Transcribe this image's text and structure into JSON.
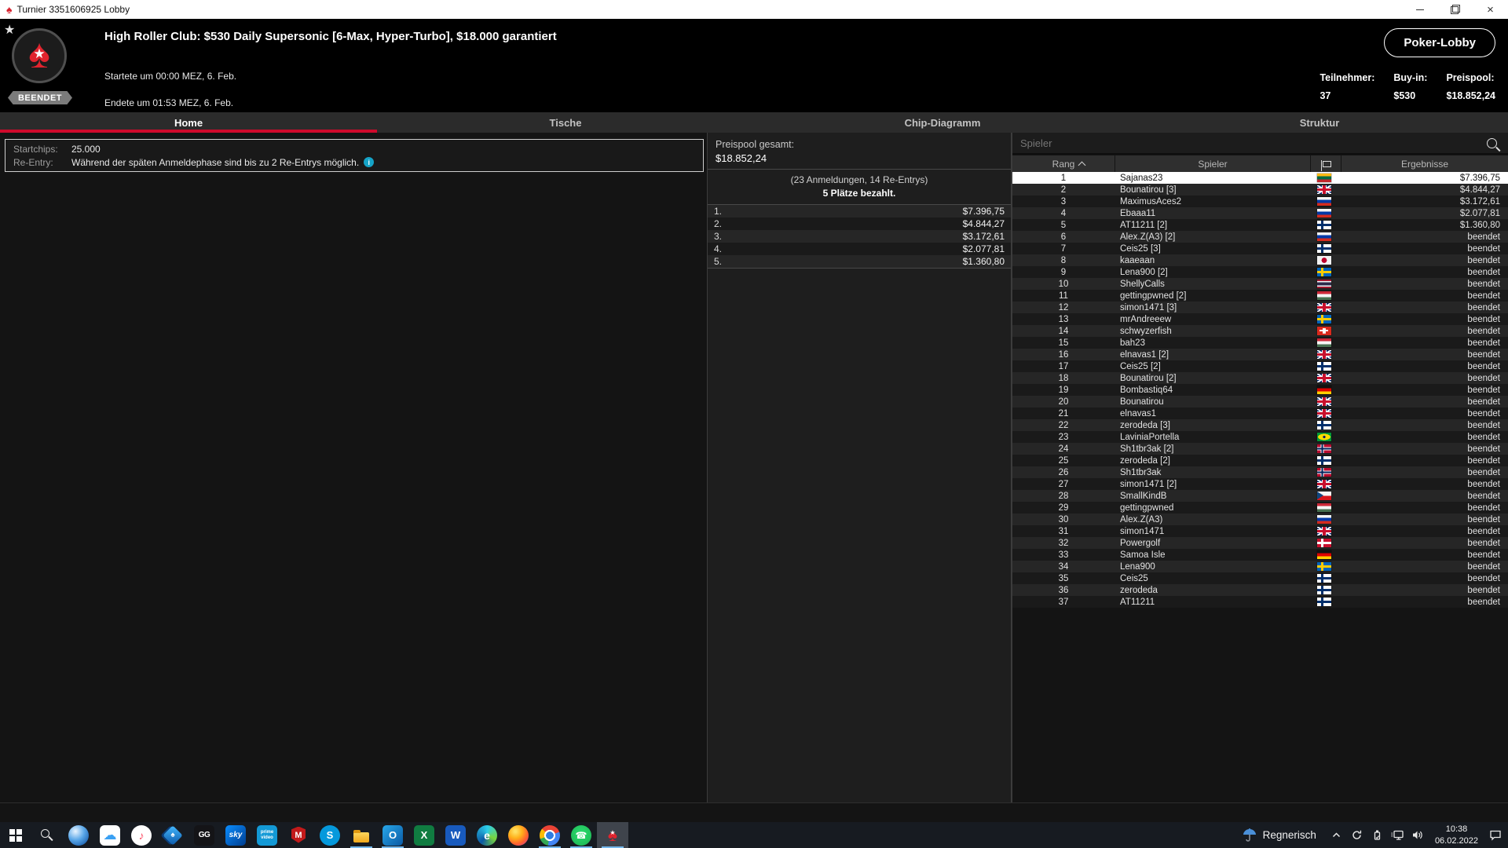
{
  "window": {
    "title": "Turnier 3351606925 Lobby"
  },
  "header": {
    "status_badge": "BEENDET",
    "title": "High Roller Club: $530 Daily Supersonic [6-Max, Hyper-Turbo], $18.000 garantiert",
    "started": "Startete um 00:00 MEZ, 6. Feb.",
    "ended": "Endete um 01:53 MEZ, 6. Feb.",
    "lobby_button": "Poker-Lobby",
    "stats": [
      {
        "label": "Teilnehmer:",
        "value": "37"
      },
      {
        "label": "Buy-in:",
        "value": "$530"
      },
      {
        "label": "Preispool:",
        "value": "$18.852,24"
      }
    ]
  },
  "tabs": [
    {
      "label": "Home",
      "active": true
    },
    {
      "label": "Tische",
      "active": false
    },
    {
      "label": "Chip-Diagramm",
      "active": false
    },
    {
      "label": "Struktur",
      "active": false
    }
  ],
  "info_panel": {
    "startchips_label": "Startchips:",
    "startchips_value": "25.000",
    "reentry_label": "Re-Entry:",
    "reentry_value": "Während der späten Anmeldephase sind bis zu 2 Re-Entrys möglich."
  },
  "prize_panel": {
    "total_label": "Preispool gesamt:",
    "total_value": "$18.852,24",
    "entries_note": "(23 Anmeldungen, 14 Re-Entrys)",
    "paid_note": "5 Plätze bezahlt.",
    "prizes": [
      {
        "place": "1.",
        "amount": "$7.396,75"
      },
      {
        "place": "2.",
        "amount": "$4.844,27"
      },
      {
        "place": "3.",
        "amount": "$3.172,61"
      },
      {
        "place": "4.",
        "amount": "$2.077,81"
      },
      {
        "place": "5.",
        "amount": "$1.360,80"
      }
    ]
  },
  "players_panel": {
    "search_placeholder": "Spieler",
    "columns": {
      "rank": "Rang",
      "player": "Spieler",
      "results": "Ergebnisse"
    },
    "rows": [
      {
        "rank": "1",
        "name": "Sajanas23",
        "country": "lt",
        "result": "$7.396,75",
        "selected": true
      },
      {
        "rank": "2",
        "name": "Bounatirou [3]",
        "country": "gb",
        "result": "$4.844,27"
      },
      {
        "rank": "3",
        "name": "MaximusAces2",
        "country": "ru",
        "result": "$3.172,61"
      },
      {
        "rank": "4",
        "name": "Ebaaa11",
        "country": "ru",
        "result": "$2.077,81"
      },
      {
        "rank": "5",
        "name": "AT11211 [2]",
        "country": "fi",
        "result": "$1.360,80"
      },
      {
        "rank": "6",
        "name": "Alex.Z(A3) [2]",
        "country": "ru",
        "result": "beendet"
      },
      {
        "rank": "7",
        "name": "Ceis25 [3]",
        "country": "fi",
        "result": "beendet"
      },
      {
        "rank": "8",
        "name": "kaaeaan",
        "country": "jp",
        "result": "beendet"
      },
      {
        "rank": "9",
        "name": "Lena900 [2]",
        "country": "se",
        "result": "beendet"
      },
      {
        "rank": "10",
        "name": "ShellyCalls",
        "country": "th",
        "result": "beendet"
      },
      {
        "rank": "11",
        "name": "gettingpwned [2]",
        "country": "hu",
        "result": "beendet"
      },
      {
        "rank": "12",
        "name": "simon1471 [3]",
        "country": "gb",
        "result": "beendet"
      },
      {
        "rank": "13",
        "name": "mrAndreeew",
        "country": "se",
        "result": "beendet"
      },
      {
        "rank": "14",
        "name": "schwyzerfish",
        "country": "ch",
        "result": "beendet"
      },
      {
        "rank": "15",
        "name": "bah23",
        "country": "hu",
        "result": "beendet"
      },
      {
        "rank": "16",
        "name": "elnavas1 [2]",
        "country": "gb",
        "result": "beendet"
      },
      {
        "rank": "17",
        "name": "Ceis25 [2]",
        "country": "fi",
        "result": "beendet"
      },
      {
        "rank": "18",
        "name": "Bounatirou [2]",
        "country": "gb",
        "result": "beendet"
      },
      {
        "rank": "19",
        "name": "Bombastiq64",
        "country": "de",
        "result": "beendet"
      },
      {
        "rank": "20",
        "name": "Bounatirou",
        "country": "gb",
        "result": "beendet"
      },
      {
        "rank": "21",
        "name": "elnavas1",
        "country": "gb",
        "result": "beendet"
      },
      {
        "rank": "22",
        "name": "zerodeda [3]",
        "country": "fi",
        "result": "beendet"
      },
      {
        "rank": "23",
        "name": "LaviniaPortella",
        "country": "br",
        "result": "beendet"
      },
      {
        "rank": "24",
        "name": "Sh1tbr3ak [2]",
        "country": "no",
        "result": "beendet"
      },
      {
        "rank": "25",
        "name": "zerodeda [2]",
        "country": "fi",
        "result": "beendet"
      },
      {
        "rank": "26",
        "name": "Sh1tbr3ak",
        "country": "no",
        "result": "beendet"
      },
      {
        "rank": "27",
        "name": "simon1471 [2]",
        "country": "gb",
        "result": "beendet"
      },
      {
        "rank": "28",
        "name": "SmallKindB",
        "country": "cz",
        "result": "beendet"
      },
      {
        "rank": "29",
        "name": "gettingpwned",
        "country": "hu",
        "result": "beendet"
      },
      {
        "rank": "30",
        "name": "Alex.Z(A3)",
        "country": "ru",
        "result": "beendet"
      },
      {
        "rank": "31",
        "name": "simon1471",
        "country": "gb",
        "result": "beendet"
      },
      {
        "rank": "32",
        "name": "Powergolf",
        "country": "dk",
        "result": "beendet"
      },
      {
        "rank": "33",
        "name": "Samoa Isle",
        "country": "de",
        "result": "beendet"
      },
      {
        "rank": "34",
        "name": "Lena900",
        "country": "se",
        "result": "beendet"
      },
      {
        "rank": "35",
        "name": "Ceis25",
        "country": "fi",
        "result": "beendet"
      },
      {
        "rank": "36",
        "name": "zerodeda",
        "country": "fi",
        "result": "beendet"
      },
      {
        "rank": "37",
        "name": "AT11211",
        "country": "fi",
        "result": "beendet"
      }
    ]
  },
  "taskbar": {
    "apps": [
      {
        "name": "start"
      },
      {
        "name": "search"
      },
      {
        "name": "chat-app"
      },
      {
        "name": "icloud"
      },
      {
        "name": "apple-music"
      },
      {
        "name": "poker-cards"
      },
      {
        "name": "ggpoker",
        "glyph": "GG"
      },
      {
        "name": "sky",
        "glyph": "sky"
      },
      {
        "name": "prime-video",
        "glyph": "prime video"
      },
      {
        "name": "mcafee",
        "glyph": "M"
      },
      {
        "name": "skype",
        "glyph": "S"
      },
      {
        "name": "file-explorer",
        "running": true
      },
      {
        "name": "outlook",
        "glyph": "O",
        "running": true
      },
      {
        "name": "excel",
        "glyph": "X"
      },
      {
        "name": "word",
        "glyph": "W"
      },
      {
        "name": "edge",
        "glyph": "e"
      },
      {
        "name": "firefox"
      },
      {
        "name": "chrome",
        "running": true
      },
      {
        "name": "whatsapp",
        "running": true
      },
      {
        "name": "pokerstars",
        "running": true,
        "active": true
      }
    ],
    "tray": {
      "weather_label": "Regnerisch",
      "time": "10:38",
      "date": "06.02.2022"
    }
  },
  "colors": {
    "accent_red": "#cf0a2c",
    "indicator_blue": "#76b9ed",
    "selected_row": "#ffffff"
  }
}
